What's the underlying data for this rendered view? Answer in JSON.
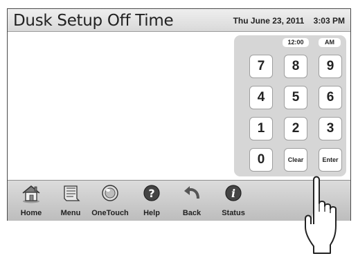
{
  "header": {
    "title": "Dusk Setup Off Time",
    "date": "Thu June 23, 2011",
    "time": "3:03 PM"
  },
  "keypad": {
    "time_display": "12:00",
    "ampm_display": "AM",
    "keys": [
      "7",
      "8",
      "9",
      "4",
      "5",
      "6",
      "1",
      "2",
      "3",
      "0",
      "Clear",
      "Enter"
    ]
  },
  "toolbar": {
    "home": "Home",
    "menu": "Menu",
    "onetouch": "OneTouch",
    "help": "Help",
    "back": "Back",
    "status": "Status"
  },
  "icons": {
    "home": "house-icon",
    "menu": "document-icon",
    "onetouch": "touch-icon",
    "help": "question-icon",
    "back": "back-arrow-icon",
    "status": "info-icon",
    "pointer": "hand-pointer-icon"
  }
}
